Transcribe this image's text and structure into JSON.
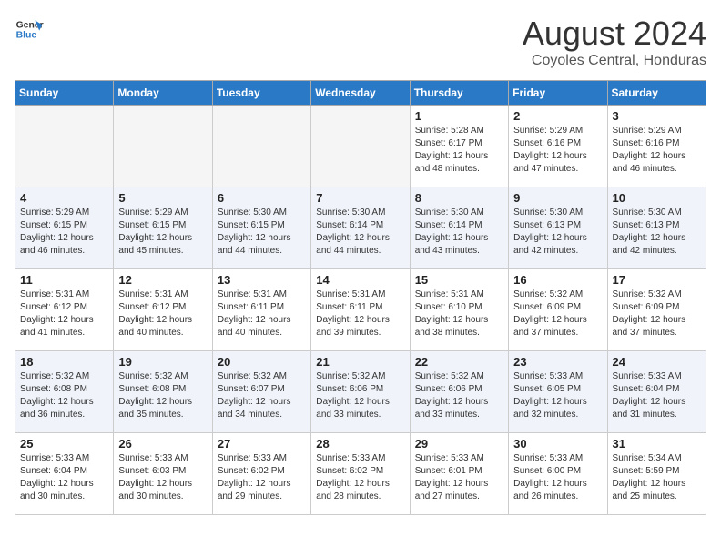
{
  "header": {
    "logo_line1": "General",
    "logo_line2": "Blue",
    "month": "August 2024",
    "location": "Coyoles Central, Honduras"
  },
  "columns": [
    "Sunday",
    "Monday",
    "Tuesday",
    "Wednesday",
    "Thursday",
    "Friday",
    "Saturday"
  ],
  "weeks": [
    [
      {
        "day": "",
        "info": ""
      },
      {
        "day": "",
        "info": ""
      },
      {
        "day": "",
        "info": ""
      },
      {
        "day": "",
        "info": ""
      },
      {
        "day": "1",
        "info": "Sunrise: 5:28 AM\nSunset: 6:17 PM\nDaylight: 12 hours\nand 48 minutes."
      },
      {
        "day": "2",
        "info": "Sunrise: 5:29 AM\nSunset: 6:16 PM\nDaylight: 12 hours\nand 47 minutes."
      },
      {
        "day": "3",
        "info": "Sunrise: 5:29 AM\nSunset: 6:16 PM\nDaylight: 12 hours\nand 46 minutes."
      }
    ],
    [
      {
        "day": "4",
        "info": "Sunrise: 5:29 AM\nSunset: 6:15 PM\nDaylight: 12 hours\nand 46 minutes."
      },
      {
        "day": "5",
        "info": "Sunrise: 5:29 AM\nSunset: 6:15 PM\nDaylight: 12 hours\nand 45 minutes."
      },
      {
        "day": "6",
        "info": "Sunrise: 5:30 AM\nSunset: 6:15 PM\nDaylight: 12 hours\nand 44 minutes."
      },
      {
        "day": "7",
        "info": "Sunrise: 5:30 AM\nSunset: 6:14 PM\nDaylight: 12 hours\nand 44 minutes."
      },
      {
        "day": "8",
        "info": "Sunrise: 5:30 AM\nSunset: 6:14 PM\nDaylight: 12 hours\nand 43 minutes."
      },
      {
        "day": "9",
        "info": "Sunrise: 5:30 AM\nSunset: 6:13 PM\nDaylight: 12 hours\nand 42 minutes."
      },
      {
        "day": "10",
        "info": "Sunrise: 5:30 AM\nSunset: 6:13 PM\nDaylight: 12 hours\nand 42 minutes."
      }
    ],
    [
      {
        "day": "11",
        "info": "Sunrise: 5:31 AM\nSunset: 6:12 PM\nDaylight: 12 hours\nand 41 minutes."
      },
      {
        "day": "12",
        "info": "Sunrise: 5:31 AM\nSunset: 6:12 PM\nDaylight: 12 hours\nand 40 minutes."
      },
      {
        "day": "13",
        "info": "Sunrise: 5:31 AM\nSunset: 6:11 PM\nDaylight: 12 hours\nand 40 minutes."
      },
      {
        "day": "14",
        "info": "Sunrise: 5:31 AM\nSunset: 6:11 PM\nDaylight: 12 hours\nand 39 minutes."
      },
      {
        "day": "15",
        "info": "Sunrise: 5:31 AM\nSunset: 6:10 PM\nDaylight: 12 hours\nand 38 minutes."
      },
      {
        "day": "16",
        "info": "Sunrise: 5:32 AM\nSunset: 6:09 PM\nDaylight: 12 hours\nand 37 minutes."
      },
      {
        "day": "17",
        "info": "Sunrise: 5:32 AM\nSunset: 6:09 PM\nDaylight: 12 hours\nand 37 minutes."
      }
    ],
    [
      {
        "day": "18",
        "info": "Sunrise: 5:32 AM\nSunset: 6:08 PM\nDaylight: 12 hours\nand 36 minutes."
      },
      {
        "day": "19",
        "info": "Sunrise: 5:32 AM\nSunset: 6:08 PM\nDaylight: 12 hours\nand 35 minutes."
      },
      {
        "day": "20",
        "info": "Sunrise: 5:32 AM\nSunset: 6:07 PM\nDaylight: 12 hours\nand 34 minutes."
      },
      {
        "day": "21",
        "info": "Sunrise: 5:32 AM\nSunset: 6:06 PM\nDaylight: 12 hours\nand 33 minutes."
      },
      {
        "day": "22",
        "info": "Sunrise: 5:32 AM\nSunset: 6:06 PM\nDaylight: 12 hours\nand 33 minutes."
      },
      {
        "day": "23",
        "info": "Sunrise: 5:33 AM\nSunset: 6:05 PM\nDaylight: 12 hours\nand 32 minutes."
      },
      {
        "day": "24",
        "info": "Sunrise: 5:33 AM\nSunset: 6:04 PM\nDaylight: 12 hours\nand 31 minutes."
      }
    ],
    [
      {
        "day": "25",
        "info": "Sunrise: 5:33 AM\nSunset: 6:04 PM\nDaylight: 12 hours\nand 30 minutes."
      },
      {
        "day": "26",
        "info": "Sunrise: 5:33 AM\nSunset: 6:03 PM\nDaylight: 12 hours\nand 30 minutes."
      },
      {
        "day": "27",
        "info": "Sunrise: 5:33 AM\nSunset: 6:02 PM\nDaylight: 12 hours\nand 29 minutes."
      },
      {
        "day": "28",
        "info": "Sunrise: 5:33 AM\nSunset: 6:02 PM\nDaylight: 12 hours\nand 28 minutes."
      },
      {
        "day": "29",
        "info": "Sunrise: 5:33 AM\nSunset: 6:01 PM\nDaylight: 12 hours\nand 27 minutes."
      },
      {
        "day": "30",
        "info": "Sunrise: 5:33 AM\nSunset: 6:00 PM\nDaylight: 12 hours\nand 26 minutes."
      },
      {
        "day": "31",
        "info": "Sunrise: 5:34 AM\nSunset: 5:59 PM\nDaylight: 12 hours\nand 25 minutes."
      }
    ]
  ]
}
